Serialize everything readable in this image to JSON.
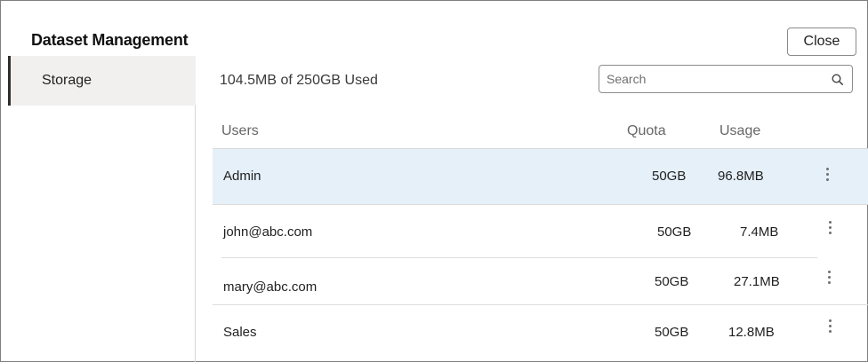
{
  "dialog": {
    "title": "Dataset Management",
    "close_label": "Close"
  },
  "sidebar": {
    "items": [
      {
        "label": "Storage",
        "selected": true
      }
    ]
  },
  "storage": {
    "summary": "104.5MB of 250GB Used",
    "search": {
      "placeholder": "Search",
      "value": "",
      "icon": "search-icon"
    },
    "columns": {
      "users": "Users",
      "quota": "Quota",
      "usage": "Usage"
    },
    "rows": [
      {
        "user": "Admin",
        "quota": "50GB",
        "usage": "96.8MB",
        "selected": true
      },
      {
        "user": "john@abc.com",
        "quota": "50GB",
        "usage": "7.4MB",
        "selected": false
      },
      {
        "user": "mary@abc.com",
        "quota": "50GB",
        "usage": "27.1MB",
        "selected": false
      },
      {
        "user": "Sales",
        "quota": "50GB",
        "usage": "12.8MB",
        "selected": false
      }
    ]
  },
  "colors": {
    "selected_row": "#e6f0f8",
    "sidebar_selected": "#f1f0ee",
    "sidebar_accent": "#312d2a"
  }
}
